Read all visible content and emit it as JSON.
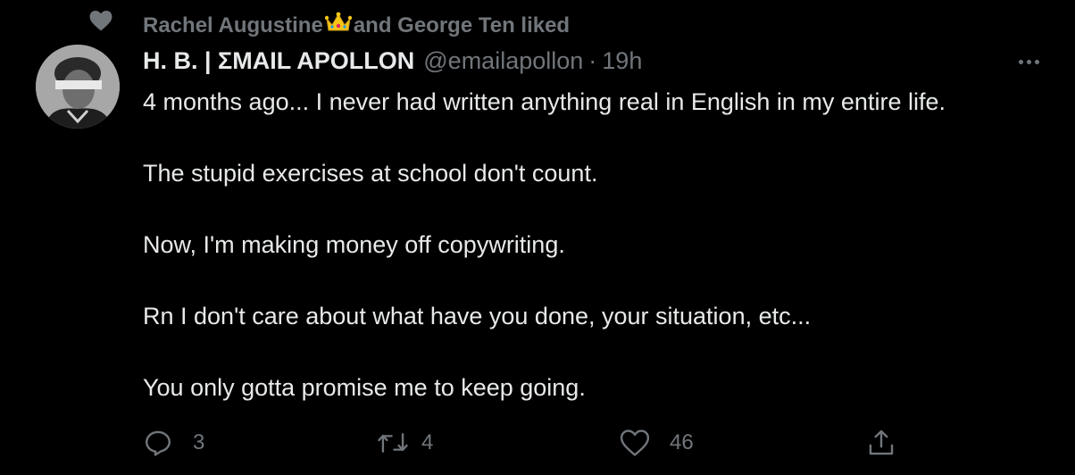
{
  "social_context": {
    "text_before": "Rachel Augustine",
    "crown_emoji": "👑",
    "text_after": "and George Ten liked",
    "icon": "heart-icon"
  },
  "author": {
    "display_name": "H. B. | ΣMAIL APOLLON",
    "handle": "@emailapollon",
    "separator": "·",
    "time": "19h"
  },
  "tweet": {
    "paragraphs": [
      "4 months ago... I never had written anything real in English in my entire life.",
      "The stupid exercises at school don't count.",
      "Now, I'm making money off copywriting.",
      "Rn I don't care about what have you done, your situation, etc...",
      "You only gotta promise me to keep going."
    ]
  },
  "actions": {
    "reply": {
      "icon": "reply-icon",
      "count": "3"
    },
    "retweet": {
      "icon": "retweet-icon",
      "count": "4"
    },
    "like": {
      "icon": "like-icon",
      "count": "46"
    },
    "share": {
      "icon": "share-icon"
    }
  },
  "more": {
    "icon": "more-dots-icon"
  },
  "colors": {
    "background": "#000000",
    "text": "#e7e9ea",
    "muted": "#71767b"
  }
}
